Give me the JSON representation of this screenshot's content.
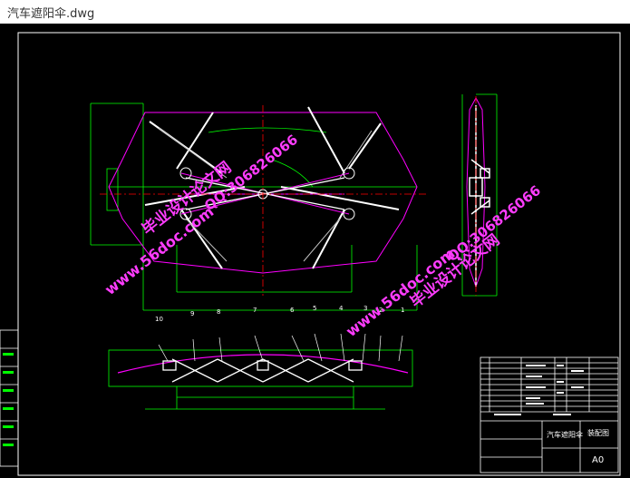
{
  "window": {
    "title": "汽车遮阳伞.dwg"
  },
  "watermarks": {
    "site": "www.56doc.com",
    "cn": "毕业设计论文网",
    "qq": "QQ:306826066"
  },
  "part_numbers": [
    "10",
    "9",
    "8",
    "7",
    "6",
    "5",
    "4",
    "3",
    "2",
    "1"
  ],
  "title_block": {
    "drawing_name": "汽车遮阳伞",
    "sheet_label": "装配图",
    "sheet_size": "A0"
  },
  "colors": {
    "frame": "#ffffff",
    "dimension": "#00ff00",
    "outline": "#ff00ff",
    "centerline": "#ff0000",
    "watermark": "#ff3cff"
  }
}
